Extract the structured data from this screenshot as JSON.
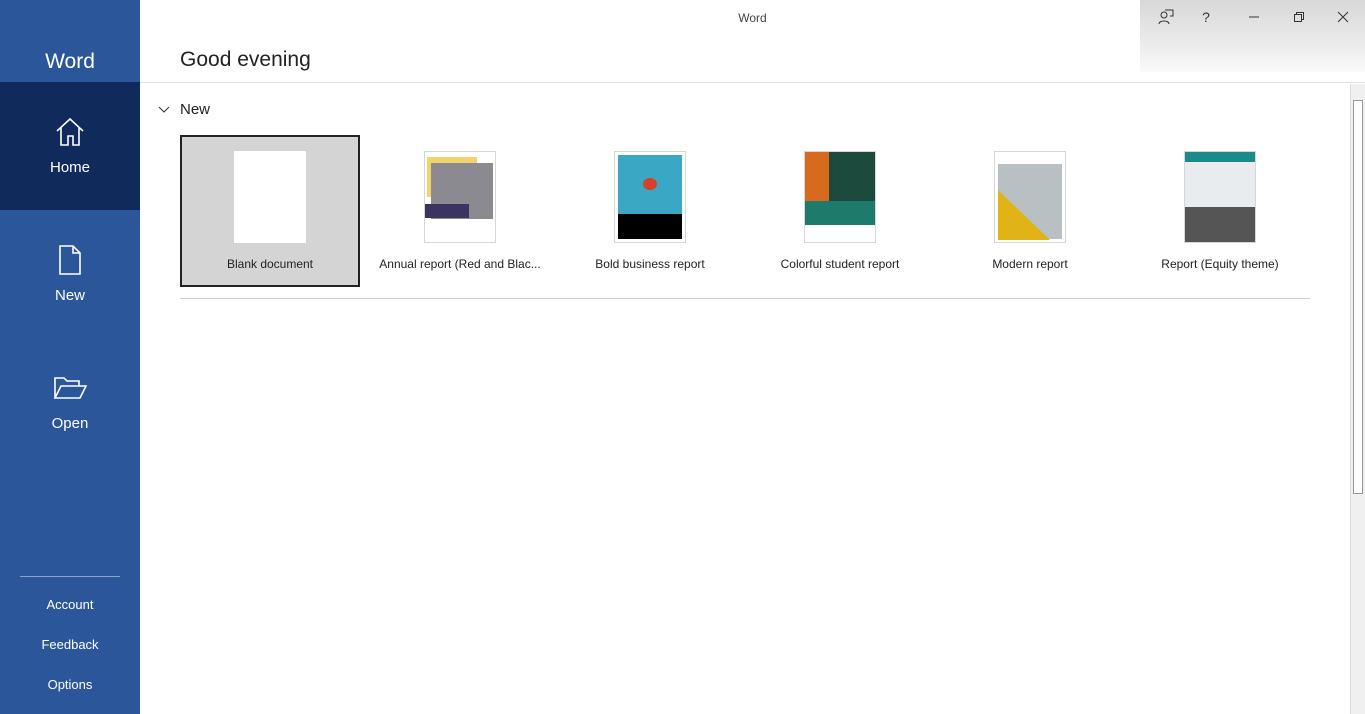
{
  "app": {
    "name": "Word",
    "window_title": "Word"
  },
  "sidebar": {
    "items": [
      {
        "label": "Home",
        "icon": "home-icon"
      },
      {
        "label": "New",
        "icon": "new-document-icon"
      },
      {
        "label": "Open",
        "icon": "folder-open-icon"
      }
    ],
    "bottom": [
      "Account",
      "Feedback",
      "Options"
    ]
  },
  "titlebar": {
    "buttons": [
      "coauthor-icon",
      "help-icon",
      "minimize-icon",
      "restore-icon",
      "close-icon"
    ],
    "help": "?"
  },
  "main": {
    "greeting": "Good evening",
    "section": "New",
    "templates": [
      {
        "name": "Blank document"
      },
      {
        "name": "Annual report (Red and Blac..."
      },
      {
        "name": "Bold business report"
      },
      {
        "name": "Colorful student report"
      },
      {
        "name": "Modern report"
      },
      {
        "name": "Report (Equity theme)"
      }
    ]
  },
  "colors": {
    "sidebar": "#2b579a",
    "active": "#102a5c"
  }
}
